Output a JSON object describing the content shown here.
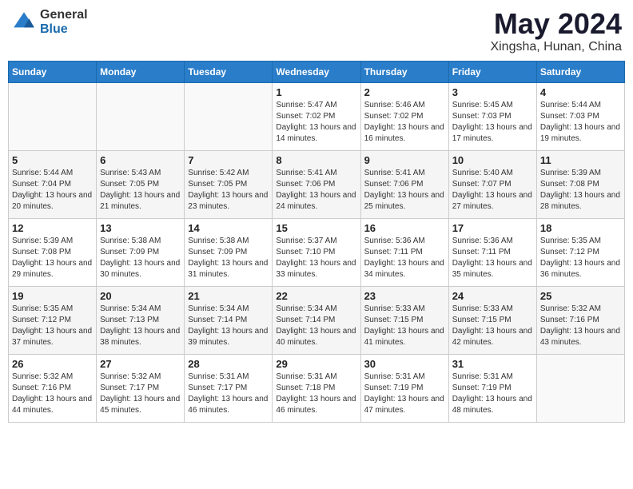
{
  "logo": {
    "general": "General",
    "blue": "Blue"
  },
  "title": "May 2024",
  "location": "Xingsha, Hunan, China",
  "days_header": [
    "Sunday",
    "Monday",
    "Tuesday",
    "Wednesday",
    "Thursday",
    "Friday",
    "Saturday"
  ],
  "weeks": [
    [
      {
        "num": "",
        "info": ""
      },
      {
        "num": "",
        "info": ""
      },
      {
        "num": "",
        "info": ""
      },
      {
        "num": "1",
        "info": "Sunrise: 5:47 AM\nSunset: 7:02 PM\nDaylight: 13 hours\nand 14 minutes."
      },
      {
        "num": "2",
        "info": "Sunrise: 5:46 AM\nSunset: 7:02 PM\nDaylight: 13 hours\nand 16 minutes."
      },
      {
        "num": "3",
        "info": "Sunrise: 5:45 AM\nSunset: 7:03 PM\nDaylight: 13 hours\nand 17 minutes."
      },
      {
        "num": "4",
        "info": "Sunrise: 5:44 AM\nSunset: 7:03 PM\nDaylight: 13 hours\nand 19 minutes."
      }
    ],
    [
      {
        "num": "5",
        "info": "Sunrise: 5:44 AM\nSunset: 7:04 PM\nDaylight: 13 hours\nand 20 minutes."
      },
      {
        "num": "6",
        "info": "Sunrise: 5:43 AM\nSunset: 7:05 PM\nDaylight: 13 hours\nand 21 minutes."
      },
      {
        "num": "7",
        "info": "Sunrise: 5:42 AM\nSunset: 7:05 PM\nDaylight: 13 hours\nand 23 minutes."
      },
      {
        "num": "8",
        "info": "Sunrise: 5:41 AM\nSunset: 7:06 PM\nDaylight: 13 hours\nand 24 minutes."
      },
      {
        "num": "9",
        "info": "Sunrise: 5:41 AM\nSunset: 7:06 PM\nDaylight: 13 hours\nand 25 minutes."
      },
      {
        "num": "10",
        "info": "Sunrise: 5:40 AM\nSunset: 7:07 PM\nDaylight: 13 hours\nand 27 minutes."
      },
      {
        "num": "11",
        "info": "Sunrise: 5:39 AM\nSunset: 7:08 PM\nDaylight: 13 hours\nand 28 minutes."
      }
    ],
    [
      {
        "num": "12",
        "info": "Sunrise: 5:39 AM\nSunset: 7:08 PM\nDaylight: 13 hours\nand 29 minutes."
      },
      {
        "num": "13",
        "info": "Sunrise: 5:38 AM\nSunset: 7:09 PM\nDaylight: 13 hours\nand 30 minutes."
      },
      {
        "num": "14",
        "info": "Sunrise: 5:38 AM\nSunset: 7:09 PM\nDaylight: 13 hours\nand 31 minutes."
      },
      {
        "num": "15",
        "info": "Sunrise: 5:37 AM\nSunset: 7:10 PM\nDaylight: 13 hours\nand 33 minutes."
      },
      {
        "num": "16",
        "info": "Sunrise: 5:36 AM\nSunset: 7:11 PM\nDaylight: 13 hours\nand 34 minutes."
      },
      {
        "num": "17",
        "info": "Sunrise: 5:36 AM\nSunset: 7:11 PM\nDaylight: 13 hours\nand 35 minutes."
      },
      {
        "num": "18",
        "info": "Sunrise: 5:35 AM\nSunset: 7:12 PM\nDaylight: 13 hours\nand 36 minutes."
      }
    ],
    [
      {
        "num": "19",
        "info": "Sunrise: 5:35 AM\nSunset: 7:12 PM\nDaylight: 13 hours\nand 37 minutes."
      },
      {
        "num": "20",
        "info": "Sunrise: 5:34 AM\nSunset: 7:13 PM\nDaylight: 13 hours\nand 38 minutes."
      },
      {
        "num": "21",
        "info": "Sunrise: 5:34 AM\nSunset: 7:14 PM\nDaylight: 13 hours\nand 39 minutes."
      },
      {
        "num": "22",
        "info": "Sunrise: 5:34 AM\nSunset: 7:14 PM\nDaylight: 13 hours\nand 40 minutes."
      },
      {
        "num": "23",
        "info": "Sunrise: 5:33 AM\nSunset: 7:15 PM\nDaylight: 13 hours\nand 41 minutes."
      },
      {
        "num": "24",
        "info": "Sunrise: 5:33 AM\nSunset: 7:15 PM\nDaylight: 13 hours\nand 42 minutes."
      },
      {
        "num": "25",
        "info": "Sunrise: 5:32 AM\nSunset: 7:16 PM\nDaylight: 13 hours\nand 43 minutes."
      }
    ],
    [
      {
        "num": "26",
        "info": "Sunrise: 5:32 AM\nSunset: 7:16 PM\nDaylight: 13 hours\nand 44 minutes."
      },
      {
        "num": "27",
        "info": "Sunrise: 5:32 AM\nSunset: 7:17 PM\nDaylight: 13 hours\nand 45 minutes."
      },
      {
        "num": "28",
        "info": "Sunrise: 5:31 AM\nSunset: 7:17 PM\nDaylight: 13 hours\nand 46 minutes."
      },
      {
        "num": "29",
        "info": "Sunrise: 5:31 AM\nSunset: 7:18 PM\nDaylight: 13 hours\nand 46 minutes."
      },
      {
        "num": "30",
        "info": "Sunrise: 5:31 AM\nSunset: 7:19 PM\nDaylight: 13 hours\nand 47 minutes."
      },
      {
        "num": "31",
        "info": "Sunrise: 5:31 AM\nSunset: 7:19 PM\nDaylight: 13 hours\nand 48 minutes."
      },
      {
        "num": "",
        "info": ""
      }
    ]
  ]
}
